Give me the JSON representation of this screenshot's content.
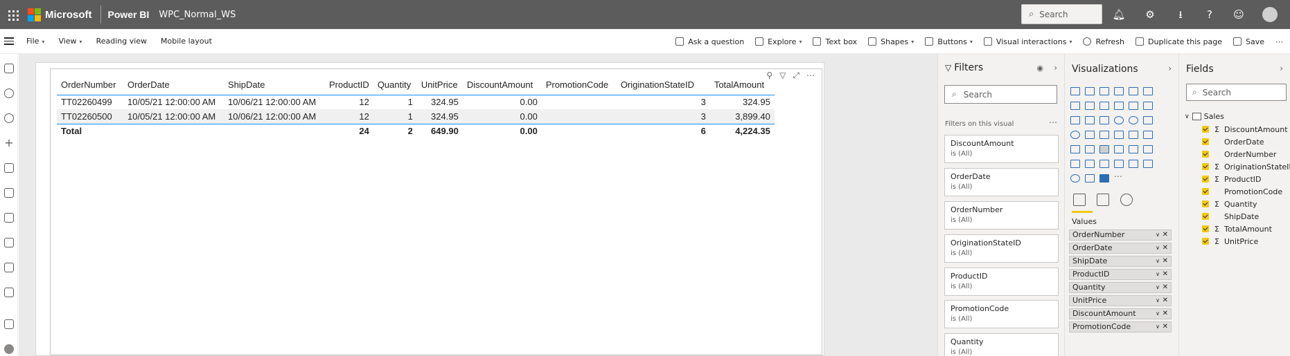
{
  "topbar": {
    "brand": "Microsoft",
    "app": "Power BI",
    "workspace": "WPC_Normal_WS",
    "search_placeholder": "Search",
    "icons": [
      "notification-icon",
      "settings-icon",
      "download-icon",
      "help-icon",
      "feedback-icon",
      "account-icon"
    ]
  },
  "ribbon": {
    "file": "File",
    "view": "View",
    "reading_view": "Reading view",
    "mobile_layout": "Mobile layout",
    "ask_question": "Ask a question",
    "explore": "Explore",
    "text_box": "Text box",
    "shapes": "Shapes",
    "buttons": "Buttons",
    "visual_interactions": "Visual interactions",
    "refresh": "Refresh",
    "duplicate_page": "Duplicate this page",
    "save": "Save",
    "more": "⋯"
  },
  "table": {
    "headers": [
      "OrderNumber",
      "OrderDate",
      "ShipDate",
      "ProductID",
      "Quantity",
      "UnitPrice",
      "DiscountAmount",
      "PromotionCode",
      "OriginationStateID",
      "TotalAmount"
    ],
    "rows": [
      [
        "TT02260499",
        "10/05/21 12:00:00 AM",
        "10/06/21 12:00:00 AM",
        "12",
        "1",
        "324.95",
        "0.00",
        "",
        "3",
        "324.95"
      ],
      [
        "TT02260500",
        "10/05/21 12:00:00 AM",
        "10/06/21 12:00:00 AM",
        "12",
        "1",
        "324.95",
        "0.00",
        "",
        "3",
        "3,899.40"
      ]
    ],
    "total": [
      "Total",
      "",
      "",
      "24",
      "2",
      "649.90",
      "0.00",
      "",
      "6",
      "4,224.35"
    ]
  },
  "filters": {
    "title": "Filters",
    "search_placeholder": "Search",
    "subtitle": "Filters on this visual",
    "more": "⋯",
    "cards": [
      {
        "name": "DiscountAmount",
        "state": "is (All)"
      },
      {
        "name": "OrderDate",
        "state": "is (All)"
      },
      {
        "name": "OrderNumber",
        "state": "is (All)"
      },
      {
        "name": "OriginationStateID",
        "state": "is (All)"
      },
      {
        "name": "ProductID",
        "state": "is (All)"
      },
      {
        "name": "PromotionCode",
        "state": "is (All)"
      },
      {
        "name": "Quantity",
        "state": "is (All)"
      }
    ]
  },
  "visualizations": {
    "title": "Visualizations",
    "values_label": "Values",
    "wells": [
      "OrderNumber",
      "OrderDate",
      "ShipDate",
      "ProductID",
      "Quantity",
      "UnitPrice",
      "DiscountAmount",
      "PromotionCode"
    ]
  },
  "fields": {
    "title": "Fields",
    "search_placeholder": "Search",
    "table_name": "Sales",
    "items": [
      {
        "name": "DiscountAmount",
        "sigma": true
      },
      {
        "name": "OrderDate",
        "sigma": false
      },
      {
        "name": "OrderNumber",
        "sigma": false
      },
      {
        "name": "OriginationStateID",
        "sigma": true
      },
      {
        "name": "ProductID",
        "sigma": true
      },
      {
        "name": "PromotionCode",
        "sigma": false
      },
      {
        "name": "Quantity",
        "sigma": true
      },
      {
        "name": "ShipDate",
        "sigma": false
      },
      {
        "name": "TotalAmount",
        "sigma": true
      },
      {
        "name": "UnitPrice",
        "sigma": true
      }
    ]
  },
  "colors": {
    "topbar": "#5c5c5c",
    "accent_yellow": "#f2c811",
    "table_rule": "#118dff",
    "pane_bg": "#f3f2f1"
  }
}
